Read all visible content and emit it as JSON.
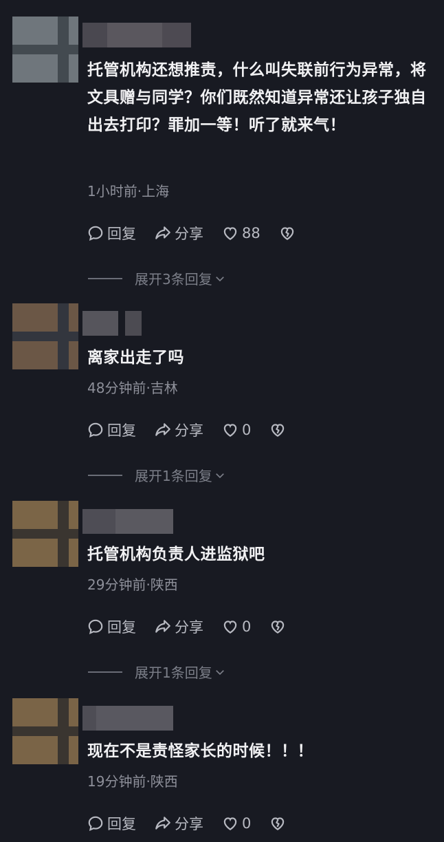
{
  "comments": [
    {
      "text": "托管机构还想推责，什么叫失联前行为异常，将文具赠与同学？你们既然知道异常还让孩子独自出去打印？罪加一等！听了就来气！",
      "meta": "1小时前·上海",
      "reply_label": "回复",
      "share_label": "分享",
      "like_count": "88",
      "expand_label": "展开3条回复",
      "avatar_colors": {
        "bg": "#6f767c",
        "bar": "#434a50"
      }
    },
    {
      "text": "离家出走了吗",
      "meta": "48分钟前·吉林",
      "reply_label": "回复",
      "share_label": "分享",
      "like_count": "0",
      "expand_label": "展开1条回复",
      "avatar_colors": {
        "bg": "#6b5746",
        "bar": "#33363e"
      }
    },
    {
      "text": "托管机构负责人进监狱吧",
      "meta": "29分钟前·陕西",
      "reply_label": "回复",
      "share_label": "分享",
      "like_count": "0",
      "expand_label": "展开1条回复",
      "avatar_colors": {
        "bg": "#7b6547",
        "bar": "#3a3530"
      }
    },
    {
      "text": "现在不是责怪家长的时候！！！",
      "meta": "19分钟前·陕西",
      "reply_label": "回复",
      "share_label": "分享",
      "like_count": "0",
      "avatar_colors": {
        "bg": "#7a6447",
        "bar": "#3a3530"
      }
    }
  ],
  "colors": {
    "background": "#181a22",
    "text": "#f1f1f3",
    "meta": "#8e909a",
    "action": "#b8bac2"
  },
  "icons": {
    "reply": "speech-bubble-icon",
    "share": "share-arrow-icon",
    "like": "heart-icon",
    "dislike": "broken-heart-icon",
    "expand": "chevron-down-icon"
  }
}
